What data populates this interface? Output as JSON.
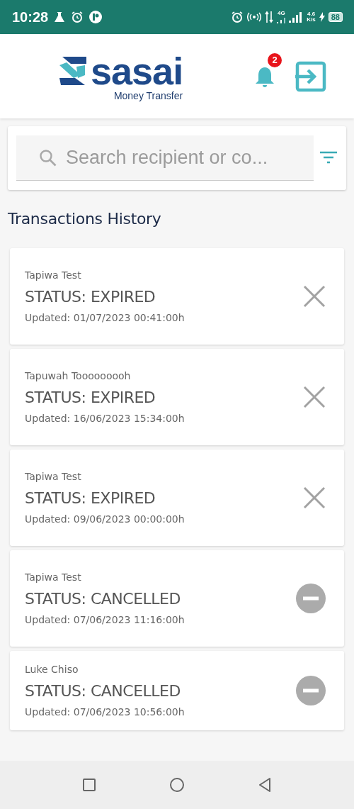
{
  "status_bar": {
    "time": "10:28",
    "network": "4G",
    "speed_value": "4.6",
    "speed_unit": "K/s",
    "battery": "88"
  },
  "header": {
    "logo_text": "sasai",
    "logo_subtitle": "Money Transfer",
    "notification_count": "2"
  },
  "search": {
    "placeholder": "Search recipient or co..."
  },
  "section_title": "Transactions History",
  "transactions": [
    {
      "recipient": "Tapiwa Test",
      "status": "STATUS: EXPIRED",
      "updated": "Updated: 01/07/2023 00:41:00h",
      "kind": "expired"
    },
    {
      "recipient": "Tapuwah Tooooooooh",
      "status": "STATUS: EXPIRED",
      "updated": "Updated: 16/06/2023 15:34:00h",
      "kind": "expired"
    },
    {
      "recipient": "Tapiwa Test",
      "status": "STATUS: EXPIRED",
      "updated": "Updated: 09/06/2023 00:00:00h",
      "kind": "expired"
    },
    {
      "recipient": "Tapiwa Test",
      "status": "STATUS: CANCELLED",
      "updated": "Updated: 07/06/2023 11:16:00h",
      "kind": "cancelled"
    },
    {
      "recipient": "Luke Chiso",
      "status": "STATUS: CANCELLED",
      "updated": "Updated: 07/06/2023 10:56:00h",
      "kind": "cancelled"
    }
  ]
}
